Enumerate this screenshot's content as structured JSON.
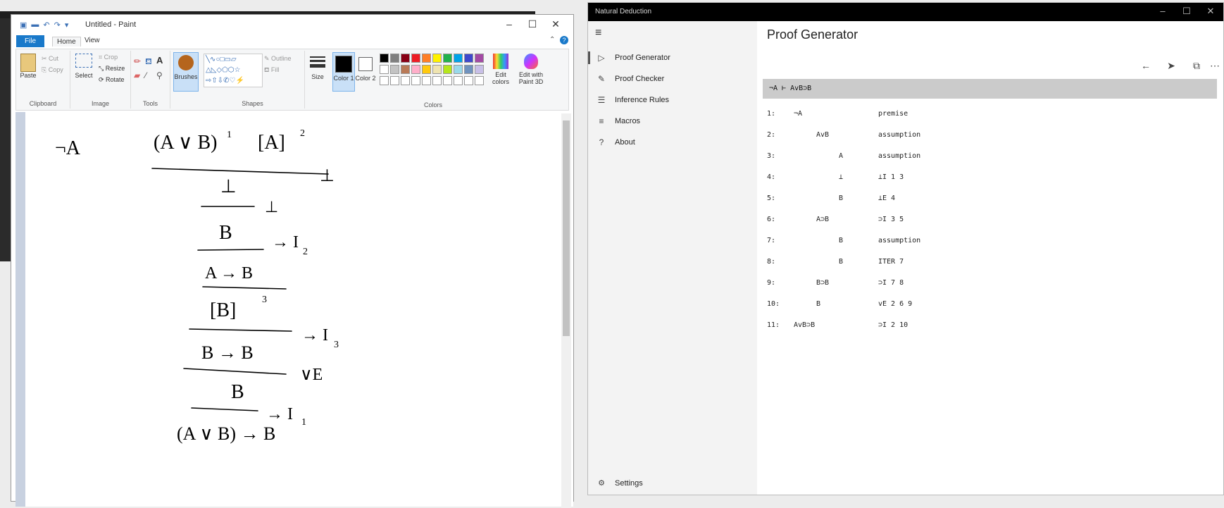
{
  "paint": {
    "qat": [
      "▣",
      "▬",
      "↶",
      "↷",
      "▾"
    ],
    "title": "Untitled - Paint",
    "tabs": {
      "file": "File",
      "home": "Home",
      "view": "View"
    },
    "clipboard": {
      "paste": "Paste",
      "cut": "Cut",
      "copy": "Copy",
      "label": "Clipboard"
    },
    "image": {
      "select": "Select",
      "crop": "Crop",
      "resize": "Resize",
      "rotate": "Rotate",
      "label": "Image"
    },
    "tools": {
      "label": "Tools",
      "brushes": "Brushes"
    },
    "shapes": {
      "outline": "Outline",
      "fill": "Fill",
      "label": "Shapes"
    },
    "size": "Size",
    "color1": "Color 1",
    "color2": "Color 2",
    "edit_colors": "Edit colors",
    "edit_paint3d": "Edit with Paint 3D",
    "colors_label": "Colors",
    "palette_top": [
      "#000000",
      "#7f7f7f",
      "#880015",
      "#ed1c24",
      "#ff7f27",
      "#fff200",
      "#22b14c",
      "#00a2e8",
      "#3f48cc",
      "#a349a4"
    ],
    "palette_mid": [
      "#ffffff",
      "#c3c3c3",
      "#b97a57",
      "#ffaec9",
      "#ffc90e",
      "#efe4b0",
      "#b5e61d",
      "#99d9ea",
      "#7092be",
      "#c8bfe7"
    ]
  },
  "nd": {
    "window_title": "Natural Deduction",
    "page_title": "Proof Generator",
    "nav": [
      {
        "icon": "▷",
        "label": "Proof Generator"
      },
      {
        "icon": "✎",
        "label": "Proof Checker"
      },
      {
        "icon": "☰",
        "label": "Inference Rules"
      },
      {
        "icon": "≡",
        "label": "Macros"
      },
      {
        "icon": "?",
        "label": "About"
      }
    ],
    "settings": "Settings",
    "goal": "¬A ⊢ AvB⊃B",
    "lines": [
      {
        "n": "1:",
        "f": "¬A",
        "d": 0,
        "j": "premise"
      },
      {
        "n": "2:",
        "f": "AvB",
        "d": 1,
        "j": "assumption"
      },
      {
        "n": "3:",
        "f": "A",
        "d": 2,
        "j": "assumption"
      },
      {
        "n": "4:",
        "f": "⊥",
        "d": 2,
        "j": "⊥I 1 3"
      },
      {
        "n": "5:",
        "f": "B",
        "d": 2,
        "j": "⊥E 4"
      },
      {
        "n": "6:",
        "f": "A⊃B",
        "d": 1,
        "j": "⊃I 3 5"
      },
      {
        "n": "7:",
        "f": "B",
        "d": 2,
        "j": "assumption"
      },
      {
        "n": "8:",
        "f": "B",
        "d": 2,
        "j": "ITER 7"
      },
      {
        "n": "9:",
        "f": "B⊃B",
        "d": 1,
        "j": "⊃I 7 8"
      },
      {
        "n": "10:",
        "f": "B",
        "d": 1,
        "j": "vE 2 6 9"
      },
      {
        "n": "11:",
        "f": "AvB⊃B",
        "d": 0,
        "j": "⊃I 2 10"
      }
    ]
  },
  "drawing": {
    "texts": [
      "¬A",
      "(A ∨ B)",
      "1",
      "[A]",
      "2",
      "⊥",
      "⊥",
      "⊥",
      "B",
      "→ I",
      "2",
      "A → B",
      "[B]",
      "3",
      "→ I",
      "3",
      "B → B",
      "∨E",
      "B",
      "→ I",
      "1",
      "(A ∨ B) → B"
    ]
  }
}
